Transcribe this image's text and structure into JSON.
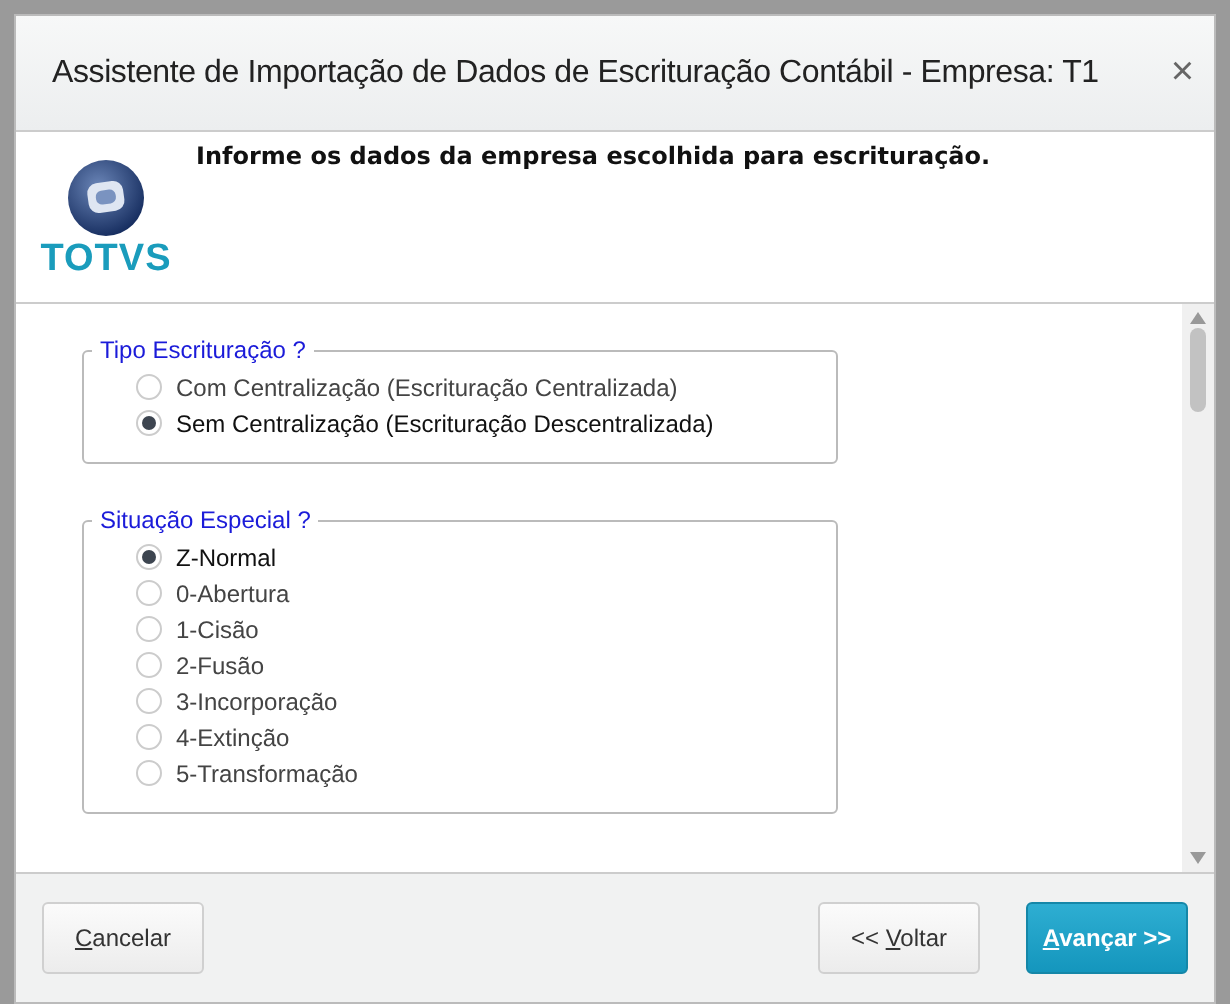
{
  "window": {
    "title": "Assistente de Importação de Dados de Escrituração Contábil - Empresa: T1",
    "close": "×"
  },
  "header": {
    "logo_text": "TOTVS",
    "message": "Informe os dados da empresa escolhida para escrituração."
  },
  "groups": [
    {
      "legend": "Tipo Escrituração ?",
      "options": [
        {
          "label": "Com Centralização (Escrituração Centralizada)",
          "selected": false
        },
        {
          "label": "Sem Centralização (Escrituração Descentralizada)",
          "selected": true
        }
      ]
    },
    {
      "legend": "Situação Especial ?",
      "options": [
        {
          "label": "Z-Normal",
          "selected": true
        },
        {
          "label": "0-Abertura",
          "selected": false
        },
        {
          "label": "1-Cisão",
          "selected": false
        },
        {
          "label": "2-Fusão",
          "selected": false
        },
        {
          "label": "3-Incorporação",
          "selected": false
        },
        {
          "label": "4-Extinção",
          "selected": false
        },
        {
          "label": "5-Transformação",
          "selected": false
        }
      ]
    }
  ],
  "buttons": [
    {
      "kind": "plain",
      "key": "C",
      "after": "ancelar"
    },
    {
      "kind": "plain",
      "before": "<< ",
      "key": "V",
      "after": "oltar"
    },
    {
      "kind": "primary",
      "key": "A",
      "after": "vançar >>"
    }
  ]
}
